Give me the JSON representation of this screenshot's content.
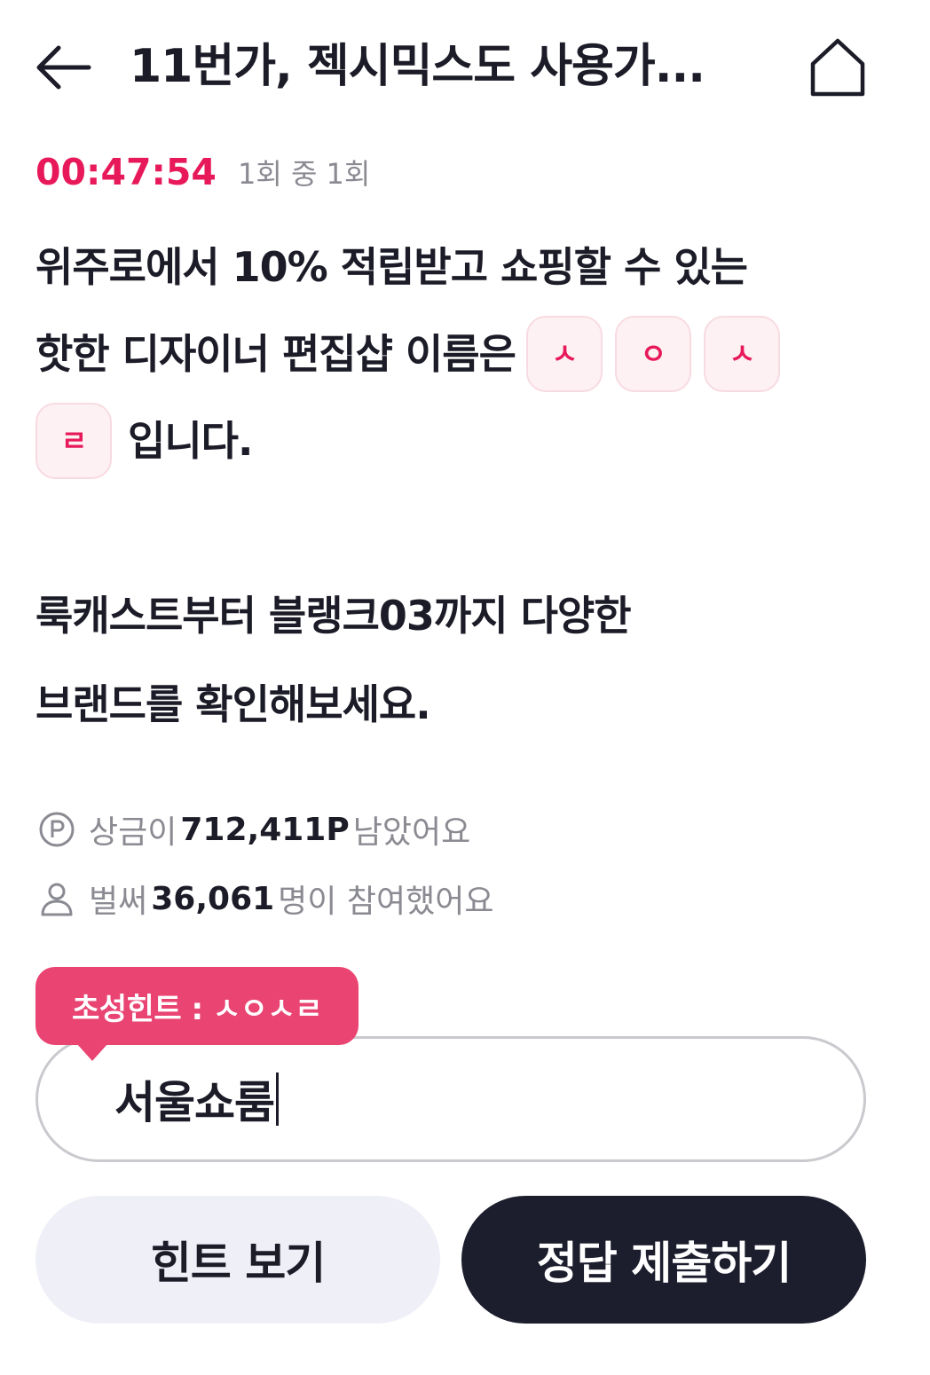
{
  "header": {
    "title": "11번가, 젝시믹스도 사용가..."
  },
  "quiz": {
    "timer": "00:47:54",
    "round": "1회 중 1회",
    "question_part1": "위주로에서 10% 적립받고 쇼핑할 수 있는",
    "question_part2": "핫한 디자이너 편집샵 이름은",
    "chips": [
      "ㅅ",
      "ㅇ",
      "ㅅ",
      "ㄹ"
    ],
    "question_part3": "입니다.",
    "description_line1": "룩캐스트부터 블랭크03까지 다양한",
    "description_line2": "브랜드를 확인해보세요."
  },
  "info": {
    "prize_prefix": "상금이",
    "prize_value": "712,411P",
    "prize_suffix": "남았어요",
    "participants_prefix": "벌써",
    "participants_value": "36,061",
    "participants_suffix": "명이 참여했어요"
  },
  "answer": {
    "hint_label": "초성힌트 : ㅅㅇㅅㄹ",
    "value": "서울쇼룸"
  },
  "buttons": {
    "hint": "힌트 보기",
    "submit": "정답 제출하기"
  },
  "colors": {
    "accent": "#e7195a",
    "hint_bubble": "#e94472",
    "submit_bg": "#1c1d2d",
    "hint_bg": "#efeff8"
  },
  "icons": {
    "back": "arrow-left-icon",
    "home": "home-icon",
    "points": "point-circle-icon",
    "person": "person-icon"
  }
}
